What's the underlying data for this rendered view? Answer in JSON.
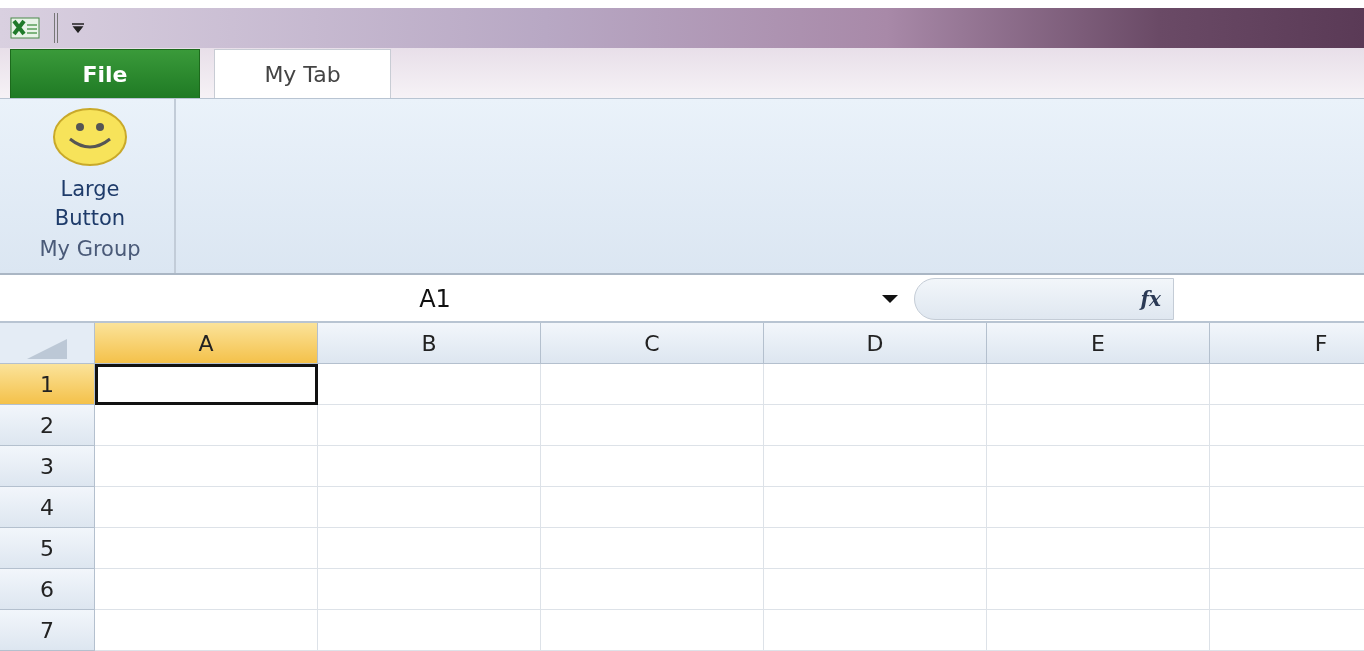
{
  "ribbon_tabs": [
    {
      "label": "File",
      "kind": "file",
      "selected": false
    },
    {
      "label": "My Tab",
      "kind": "tab",
      "selected": true
    }
  ],
  "ribbon_group": {
    "button_label": "Large Button",
    "group_label": "My Group"
  },
  "formula_bar": {
    "name_box": "A1",
    "function_label": "fx"
  },
  "sheet": {
    "columns": [
      {
        "label": "A",
        "selected": true
      },
      {
        "label": "B",
        "selected": false
      },
      {
        "label": "C",
        "selected": false
      },
      {
        "label": "D",
        "selected": false
      },
      {
        "label": "E",
        "selected": false
      },
      {
        "label": "F",
        "selected": false
      }
    ],
    "rows": [
      {
        "label": "1",
        "selected": true
      },
      {
        "label": "2",
        "selected": false
      },
      {
        "label": "3",
        "selected": false
      },
      {
        "label": "4",
        "selected": false
      },
      {
        "label": "5",
        "selected": false
      },
      {
        "label": "6",
        "selected": false
      },
      {
        "label": "7",
        "selected": false
      }
    ]
  }
}
